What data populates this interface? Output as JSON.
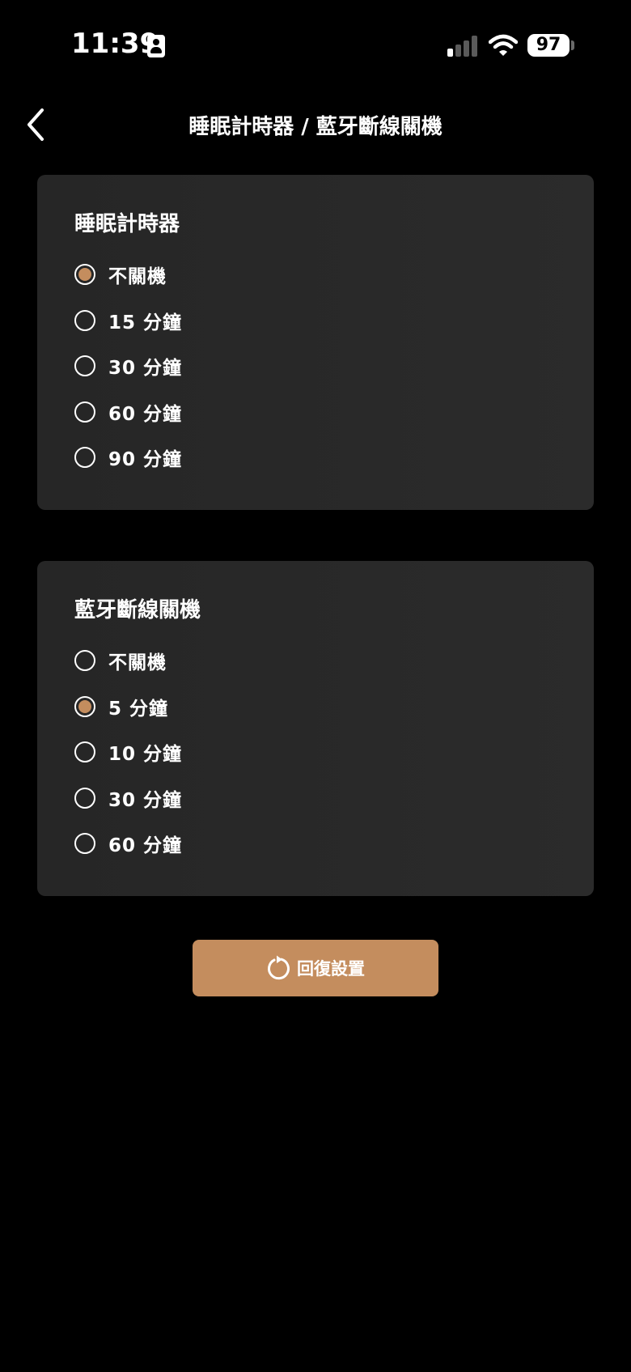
{
  "status_bar": {
    "time": "11:39",
    "battery": "97"
  },
  "nav": {
    "title": "睡眠計時器 / 藍牙斷線關機"
  },
  "sleep_timer": {
    "title": "睡眠計時器",
    "options": [
      {
        "label": "不關機",
        "selected": true
      },
      {
        "label": "15 分鐘",
        "selected": false
      },
      {
        "label": "30 分鐘",
        "selected": false
      },
      {
        "label": "60 分鐘",
        "selected": false
      },
      {
        "label": "90 分鐘",
        "selected": false
      }
    ]
  },
  "bt_disconnect": {
    "title": "藍牙斷線關機",
    "options": [
      {
        "label": "不關機",
        "selected": false
      },
      {
        "label": "5 分鐘",
        "selected": true
      },
      {
        "label": "10 分鐘",
        "selected": false
      },
      {
        "label": "30 分鐘",
        "selected": false
      },
      {
        "label": "60 分鐘",
        "selected": false
      }
    ]
  },
  "reset": {
    "label": "回復設置",
    "icon": "reset-icon"
  },
  "colors": {
    "accent": "#c48d5e",
    "background": "#000000",
    "card": "#2a2a2a"
  }
}
